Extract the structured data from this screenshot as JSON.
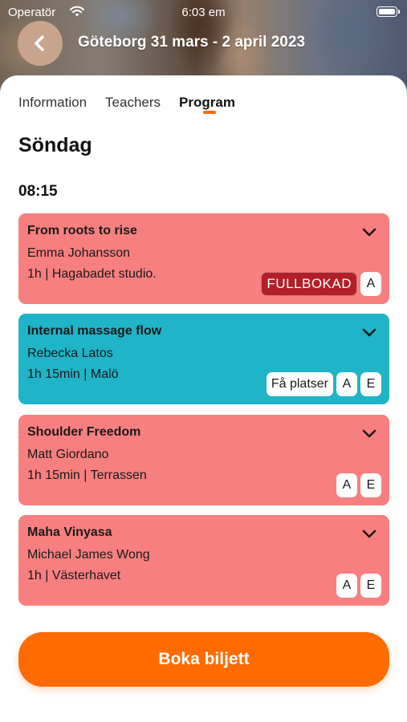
{
  "status_bar": {
    "carrier": "Operatör",
    "time": "6:03 em"
  },
  "header": {
    "title": "Göteborg 31 mars - 2 april 2023",
    "back_icon": "chevron-left-icon"
  },
  "tabs": [
    {
      "label": "Information",
      "active": false
    },
    {
      "label": "Teachers",
      "active": false
    },
    {
      "label": "Program",
      "active": true
    }
  ],
  "program": {
    "day": "Söndag",
    "time_slot": "08:15",
    "sessions": [
      {
        "title": "From roots to rise",
        "teacher": "Emma Johansson",
        "meta": "1h  | Hagabadet studio.",
        "color": "#f77f7f",
        "status_badge": "FULLBOKAD",
        "level_badges": [
          "A"
        ]
      },
      {
        "title": "Internal massage flow",
        "teacher": "Rebecka Latos",
        "meta": "1h 15min | Malö",
        "color": "#1fb4c7",
        "status_badge": "Få platser",
        "level_badges": [
          "A",
          "E"
        ]
      },
      {
        "title": "Shoulder Freedom",
        "teacher": "Matt Giordano",
        "meta": "1h 15min | Terrassen",
        "color": "#f77f7f",
        "status_badge": "",
        "level_badges": [
          "A",
          "E"
        ]
      },
      {
        "title": "Maha Vinyasa",
        "teacher": "Michael James Wong",
        "meta": "1h  | Västerhavet",
        "color": "#f77f7f",
        "status_badge": "",
        "level_badges": [
          "A",
          "E"
        ]
      }
    ]
  },
  "cta": {
    "label": "Boka biljett",
    "color": "#ff6b00"
  }
}
